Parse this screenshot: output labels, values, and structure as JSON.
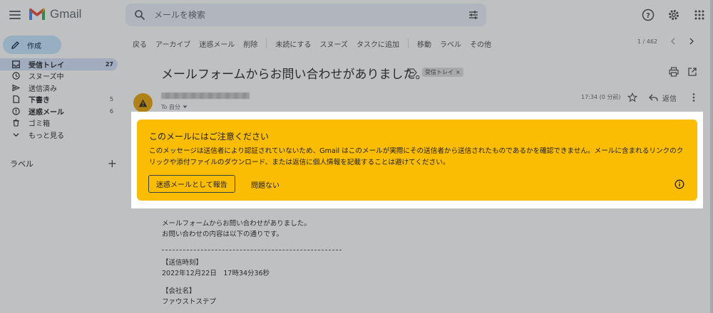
{
  "app": {
    "name": "Gmail"
  },
  "search": {
    "placeholder": "メールを検索"
  },
  "compose": {
    "label": "作成"
  },
  "nav": [
    {
      "label": "受信トレイ",
      "count": "27",
      "icon": "inbox-icon",
      "active": true
    },
    {
      "label": "スヌーズ中",
      "count": "",
      "icon": "clock-icon"
    },
    {
      "label": "送信済み",
      "count": "",
      "icon": "send-icon"
    },
    {
      "label": "下書き",
      "count": "5",
      "icon": "draft-icon",
      "bold": true
    },
    {
      "label": "迷惑メール",
      "count": "6",
      "icon": "spam-icon",
      "bold": true
    },
    {
      "label": "ゴミ箱",
      "count": "",
      "icon": "trash-icon"
    },
    {
      "label": "もっと見る",
      "count": "",
      "icon": "chevron-down-icon"
    }
  ],
  "labels_header": {
    "title": "ラベル",
    "add": "+"
  },
  "toolbar": {
    "back": "戻る",
    "archive": "アーカイブ",
    "spam": "迷惑メール",
    "delete": "削除",
    "unread": "未読にする",
    "snooze": "スヌーズ",
    "task": "タスクに追加",
    "move": "移動",
    "label": "ラベル",
    "more": "その他",
    "pager": "1 / 462"
  },
  "message": {
    "subject": "メールフォームからお問い合わせがありました。",
    "label_chip": "受信トレイ",
    "label_chip_close": "×",
    "to": "To 自分",
    "time": "17:34 (0 分前)",
    "reply": "返信"
  },
  "warning": {
    "title": "このメールにはご注意ください",
    "body": "このメッセージは送信者により認証されていないため、Gmail はこのメールが実際にその送信者から送信されたものであるかを確認できません。メールに含まれるリンクのクリックや添付ファイルのダウンロード、または返信に個人情報を記載することは避けてください。",
    "report_button": "迷惑メールとして報告",
    "dismiss_link": "問題ない"
  },
  "body": {
    "line1": "メールフォームからお問い合わせがありました。",
    "line2": "お問い合わせの内容は以下の通りです。",
    "field1_label": "【送信時刻】",
    "field1_value": "2022年12月22日　17時34分36秒",
    "field2_label": "【会社名】",
    "field2_value": "ファウストステプ"
  },
  "colors": {
    "warning_bg": "#fbbc04",
    "compose_bg": "#c2e7ff",
    "active_nav": "#d3e3fd",
    "avatar": "#e8a200"
  }
}
